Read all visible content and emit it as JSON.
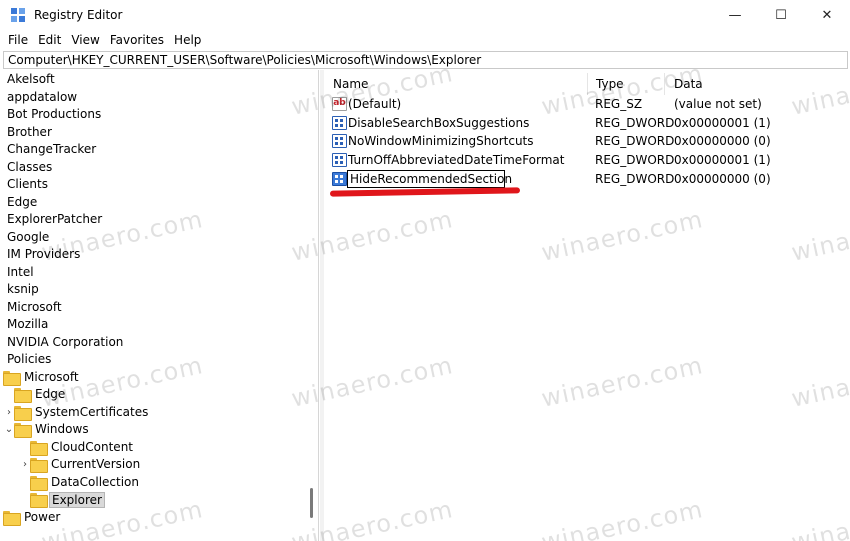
{
  "window": {
    "title": "Registry Editor",
    "controls": {
      "minimize": "—",
      "maximize": "☐",
      "close": "✕"
    }
  },
  "menu": [
    "File",
    "Edit",
    "View",
    "Favorites",
    "Help"
  ],
  "address": "Computer\\HKEY_CURRENT_USER\\Software\\Policies\\Microsoft\\Windows\\Explorer",
  "tree": {
    "top_items": [
      "Akelsoft",
      "appdatalow",
      "Bot Productions",
      "Brother",
      "ChangeTracker",
      "Classes",
      "Clients",
      "Edge",
      "ExplorerPatcher",
      "Google",
      "IM Providers",
      "Intel",
      "ksnip",
      "Microsoft",
      "Mozilla",
      "NVIDIA Corporation",
      "Policies"
    ],
    "policies_microsoft": "Microsoft",
    "microsoft_children": [
      "Edge",
      "SystemCertificates",
      "Windows"
    ],
    "windows_children": [
      "CloudContent",
      "CurrentVersion",
      "DataCollection",
      "Explorer"
    ],
    "last": "Power",
    "expanded_glyph": "⌄",
    "collapsed_glyph": "›"
  },
  "list": {
    "columns": {
      "name": "Name",
      "type": "Type",
      "data": "Data"
    },
    "rows": [
      {
        "name": "(Default)",
        "type": "REG_SZ",
        "data": "(value not set)",
        "icon": "string-value-icon"
      },
      {
        "name": "DisableSearchBoxSuggestions",
        "type": "REG_DWORD",
        "data": "0x00000001 (1)",
        "icon": "dword-value-icon"
      },
      {
        "name": "NoWindowMinimizingShortcuts",
        "type": "REG_DWORD",
        "data": "0x00000000 (0)",
        "icon": "dword-value-icon"
      },
      {
        "name": "TurnOffAbbreviatedDateTimeFormat",
        "type": "REG_DWORD",
        "data": "0x00000001 (1)",
        "icon": "dword-value-icon"
      },
      {
        "name": "HideRecommendedSection",
        "type": "REG_DWORD",
        "data": "0x00000000 (0)",
        "icon": "dword-value-icon"
      }
    ]
  },
  "watermark": "winaero.com",
  "colors": {
    "accent_underline": "#e0161b",
    "selection": "#d9d9d9",
    "desktop": "#5fd35a"
  }
}
